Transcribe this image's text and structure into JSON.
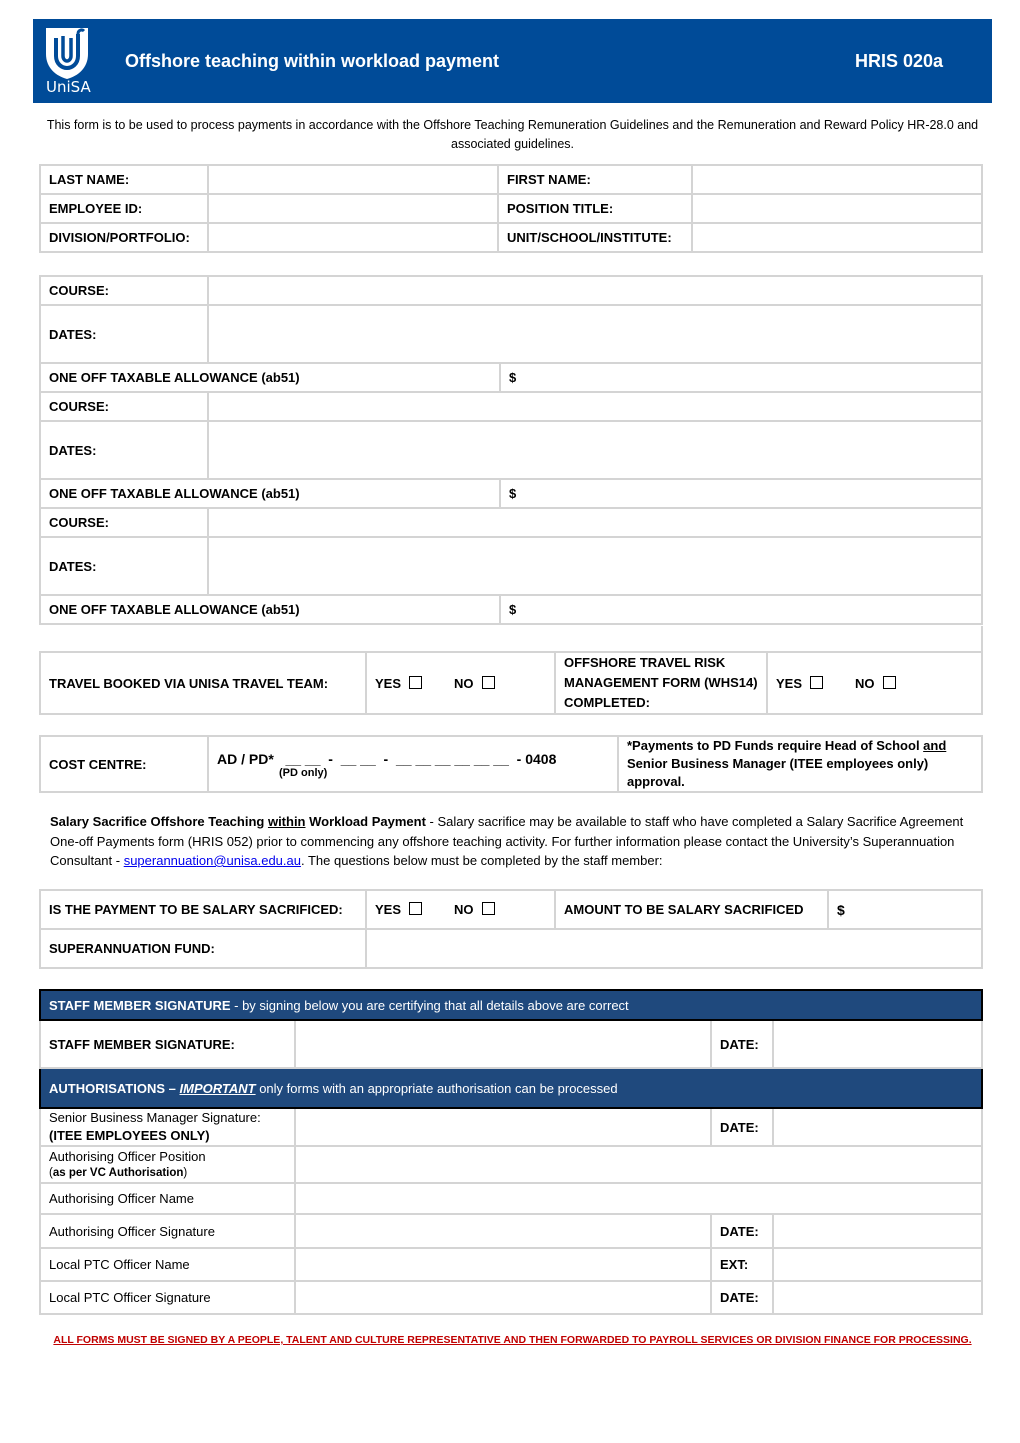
{
  "header": {
    "logo_text": "UniSA",
    "title": "Offshore teaching within workload payment",
    "form_code": "HRIS 020a",
    "brand_color": "#004b98"
  },
  "intro": "This form is to be used to process payments in accordance with the Offshore Teaching Remuneration Guidelines and the Remuneration and Reward Policy HR-28.0 and associated guidelines.",
  "personal": {
    "last_name": "LAST NAME:",
    "first_name": "FIRST NAME:",
    "employee_id": "EMPLOYEE ID:",
    "position_title": "POSITION TITLE:",
    "division": "DIVISION/PORTFOLIO:",
    "unit": "UNIT/SCHOOL/INSTITUTE:"
  },
  "courses": [
    {
      "course": "COURSE:",
      "dates": "DATES:",
      "allowance": "ONE OFF TAXABLE ALLOWANCE (ab51)",
      "currency": "$"
    },
    {
      "course": "COURSE:",
      "dates": "DATES:",
      "allowance": "ONE OFF TAXABLE ALLOWANCE (ab51)",
      "currency": "$"
    },
    {
      "course": "COURSE:",
      "dates": "DATES:",
      "allowance": "ONE OFF TAXABLE ALLOWANCE (ab51)",
      "currency": "$"
    }
  ],
  "travel": {
    "booked_label": "TRAVEL BOOKED VIA UNISA TRAVEL TEAM:",
    "risk_label": "OFFSHORE TRAVEL RISK MANAGEMENT FORM (WHS14) COMPLETED:",
    "yes": "YES",
    "no": "NO"
  },
  "cost_centre": {
    "label": "COST CENTRE:",
    "prefix": "AD / PD*",
    "pattern": "__ __  -  __ __  -  __ __ __ __ __ __",
    "suffix": "- 0408",
    "pd_only": "(PD only)",
    "note_pre": "*Payments to PD Funds require Head of School ",
    "note_and": "and",
    "note_post": " Senior Business Manager (ITEE employees only) approval."
  },
  "salary_sacrifice": {
    "heading_a": "Salary Sacrifice Offshore Teaching ",
    "heading_within": "within",
    "heading_b": " Workload Payment",
    "body_a": " - Salary sacrifice may be available to staff who have completed a Salary Sacrifice Agreement One-off Payments form (HRIS 052) prior to commencing any offshore teaching activity.  For further information please contact the University’s Superannuation Consultant - ",
    "email": "superannuation@unisa.edu.au",
    "body_b": ". The questions below must be completed by the staff member:",
    "question": "IS THE PAYMENT TO BE SALARY SACRIFICED:",
    "yes": "YES",
    "no": "NO",
    "amount_label": "AMOUNT TO BE SALARY SACRIFICED",
    "currency": "$",
    "fund_label": "SUPERANNUATION FUND:"
  },
  "staff_signature": {
    "bar_bold": "STAFF MEMBER SIGNATURE",
    "bar_rest": " - by signing below you are certifying that all details above are correct",
    "label": "STAFF MEMBER SIGNATURE:",
    "date": "DATE:",
    "bar_color": "#1f497d"
  },
  "authorisations": {
    "bar_bold": "AUTHORISATIONS – ",
    "bar_important": "IMPORTANT",
    "bar_rest": "  only forms with an appropriate authorisation can be processed",
    "rows": [
      {
        "label": "Senior Business Manager Signature:",
        "sub": "(ITEE EMPLOYEES ONLY)",
        "right": "DATE:"
      },
      {
        "label": "Authorising Officer Position",
        "sub_pre": "(",
        "sub": "as per VC Authorisation",
        "sub_post": ")",
        "right": ""
      },
      {
        "label": "Authorising Officer Name",
        "right": ""
      },
      {
        "label": "Authorising Officer Signature",
        "right": "DATE:"
      },
      {
        "label": "Local PTC Officer Name",
        "right": "EXT:"
      },
      {
        "label": "Local PTC Officer Signature",
        "right": "DATE:"
      }
    ]
  },
  "footer": "ALL FORMS MUST BE SIGNED BY A PEOPLE, TALENT AND CULTURE REPRESENTATIVE AND THEN FORWARDED TO PAYROLL SERVICES OR DIVISION FINANCE FOR PROCESSING."
}
